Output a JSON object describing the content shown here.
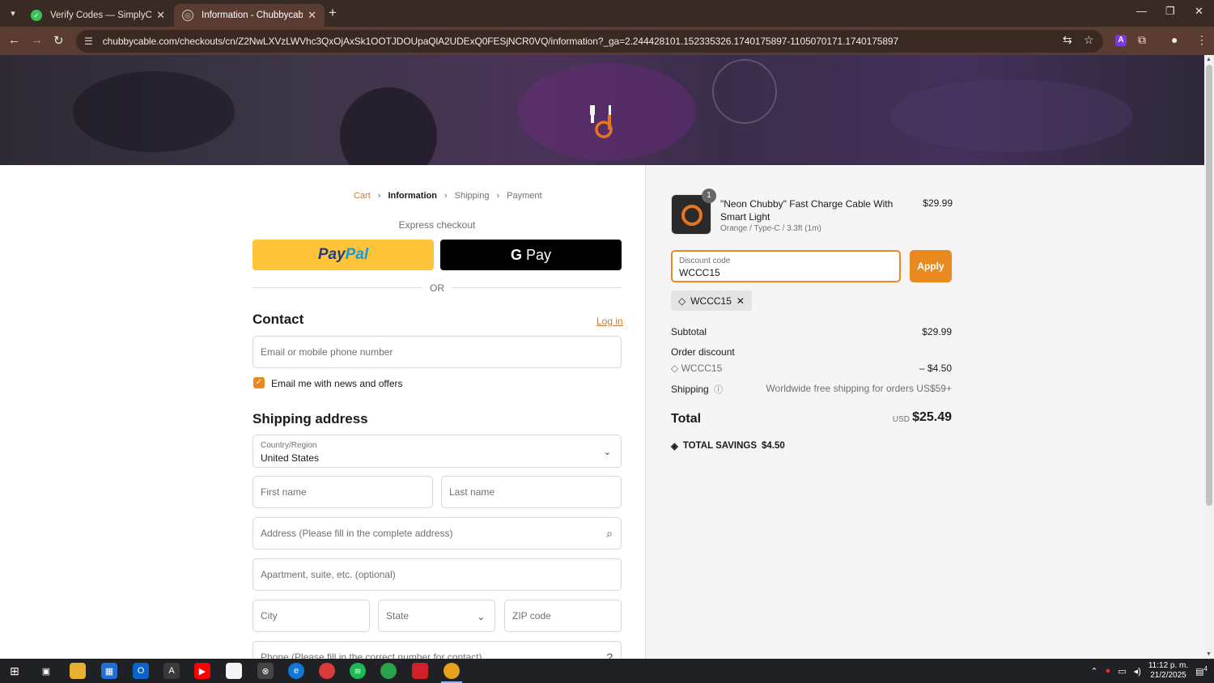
{
  "browser": {
    "tabs": [
      {
        "title": "Verify Codes — SimplyCodes",
        "active": false
      },
      {
        "title": "Information - Chubbycable - Ch",
        "active": true
      }
    ],
    "url": "chubbycable.com/checkouts/cn/Z2NwLXVzLWVhc3QxOjAxSk1OOTJDOUpaQlA2UDExQ0FESjNCR0VQ/information?_ga=2.244428101.152335326.1740175897-1105070171.1740175897"
  },
  "breadcrumb": [
    "Cart",
    "Information",
    "Shipping",
    "Payment"
  ],
  "express_checkout": {
    "label": "Express checkout",
    "paypal_a": "Pay",
    "paypal_b": "Pal",
    "gpay_g": "G",
    "gpay_label": "Pay",
    "or_label": "OR"
  },
  "contact": {
    "heading": "Contact",
    "login_link": "Log in",
    "email_placeholder": "Email or mobile phone number",
    "newsletter_label": "Email me with news and offers",
    "newsletter_checked": true
  },
  "shipping": {
    "heading": "Shipping address",
    "country_label": "Country/Region",
    "country_value": "United States",
    "first_name": "First name",
    "last_name": "Last name",
    "address": "Address (Please fill in the complete address)",
    "apartment": "Apartment, suite, etc. (optional)",
    "city": "City",
    "state": "State",
    "zip": "ZIP code",
    "phone": "Phone (Please fill in the correct number for contact)"
  },
  "order": {
    "product": {
      "quantity": "1",
      "name": "\"Neon Chubby\" Fast Charge Cable With Smart Light",
      "variant": "Orange / Type-C / 3.3ft (1m)",
      "price": "$29.99"
    },
    "discount": {
      "label": "Discount code",
      "value": "WCCC15",
      "apply": "Apply",
      "chip": "WCCC15"
    },
    "subtotal_label": "Subtotal",
    "subtotal_value": "$29.99",
    "order_discount_label": "Order discount",
    "discount_code": "WCCC15",
    "discount_value": "– $4.50",
    "shipping_label": "Shipping",
    "shipping_value": "Worldwide free shipping for orders US$59+",
    "total_label": "Total",
    "currency": "USD",
    "total_value": "$25.49",
    "savings_label": "TOTAL SAVINGS",
    "savings_value": "$4.50"
  },
  "taskbar": {
    "time": "11:12 p. m.",
    "date": "21/2/2025",
    "notifications": "4"
  },
  "colors": {
    "accent": "#e88a1f",
    "browser_frame": "#5a3c32"
  }
}
